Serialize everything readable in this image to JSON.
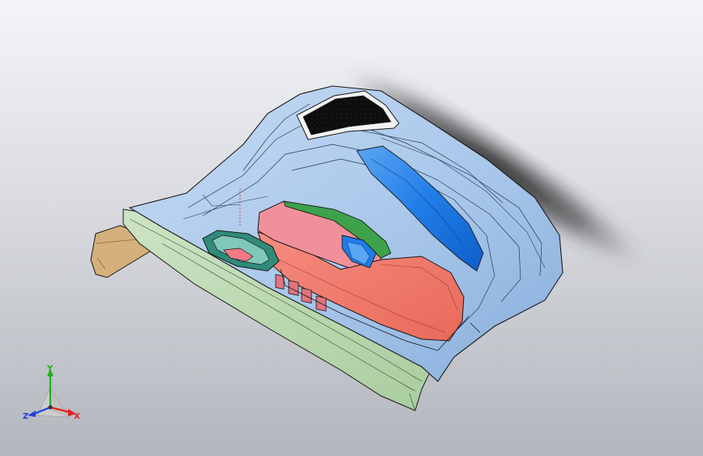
{
  "viewport": {
    "background_top": "#f4f5f8",
    "background_bottom": "#b3b6bd"
  },
  "model": {
    "description_icon": "door-trim-panel-3d-model",
    "colors": {
      "body_blue": "#a9c7ea",
      "body_blue_shade": "#7ea6d8",
      "bright_blue": "#1f7ce8",
      "pink": "#f27b86",
      "salmon": "#f0796a",
      "green": "#3ea24a",
      "teal": "#2f8c7a",
      "tan": "#d4b07c",
      "light_green": "#b9d7b0",
      "speaker_black": "#111111",
      "edge": "#1a1a1a"
    }
  },
  "triad": {
    "x_label": "X",
    "y_label": "Y",
    "z_label": "Z",
    "x_color": "#e02020",
    "y_color": "#20b020",
    "z_color": "#2040e0"
  }
}
